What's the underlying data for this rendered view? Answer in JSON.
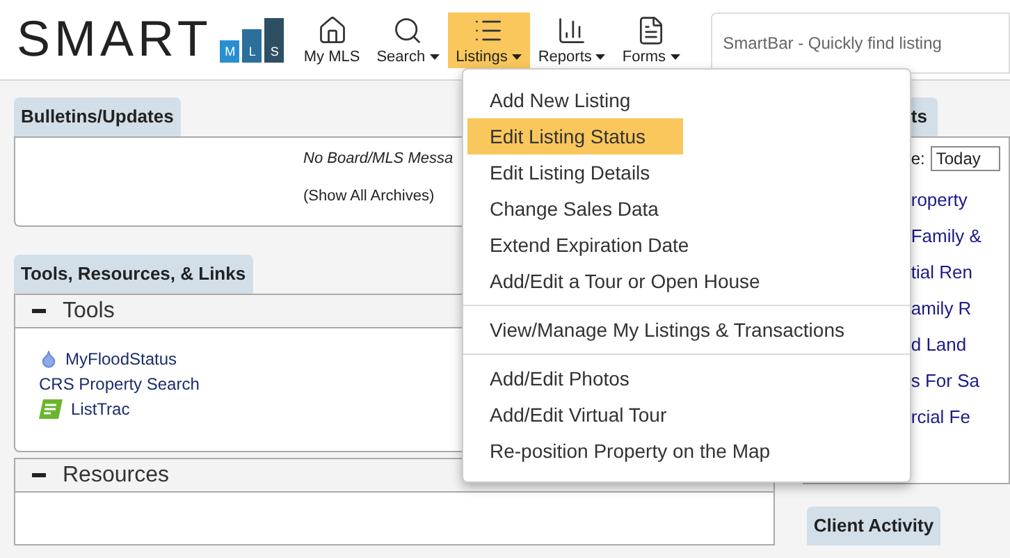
{
  "logo": {
    "text": "SMART",
    "badges": [
      "M",
      "L",
      "S"
    ]
  },
  "nav": [
    {
      "label": "My MLS",
      "kind": "home",
      "caret": false,
      "selected": false
    },
    {
      "label": "Search",
      "kind": "search",
      "caret": true,
      "selected": false
    },
    {
      "label": "Listings",
      "kind": "list",
      "caret": true,
      "selected": true
    },
    {
      "label": "Reports",
      "kind": "chart",
      "caret": true,
      "selected": false
    },
    {
      "label": "Forms",
      "kind": "form",
      "caret": true,
      "selected": false
    }
  ],
  "smartbar": {
    "placeholder": "SmartBar - Quickly find listing"
  },
  "bulletins": {
    "title": "Bulletins/Updates",
    "message": "No Board/MLS Messa",
    "link": "(Show All Archives)"
  },
  "tools_section": {
    "title": "Tools, Resources, & Links",
    "groups": [
      {
        "title": "Tools",
        "expanded": true,
        "items": [
          {
            "label": "MyFloodStatus",
            "kind": "drop"
          },
          {
            "label": "CRS Property Search",
            "kind": "plain"
          },
          {
            "label": "ListTrac",
            "kind": "listtrac"
          }
        ]
      },
      {
        "title": "Resources",
        "expanded": true
      }
    ]
  },
  "right_panel": {
    "title": "ts",
    "filter_label": "e:",
    "filter_value": "Today",
    "links": [
      "roperty",
      "Family &",
      "tial Ren",
      "amily R",
      "d Land",
      "s For Sa",
      "rcial Fe"
    ]
  },
  "client_activity": {
    "title": "Client Activity"
  },
  "listings_menu": {
    "groups": [
      [
        {
          "label": "Add New Listing",
          "selected": false
        },
        {
          "label": "Edit Listing Status",
          "selected": true
        },
        {
          "label": "Edit Listing Details",
          "selected": false
        },
        {
          "label": "Change Sales Data",
          "selected": false
        },
        {
          "label": "Extend Expiration Date",
          "selected": false
        },
        {
          "label": "Add/Edit a Tour or Open House",
          "selected": false
        }
      ],
      [
        {
          "label": "View/Manage My Listings & Transactions",
          "selected": false
        }
      ],
      [
        {
          "label": "Add/Edit Photos",
          "selected": false
        },
        {
          "label": "Add/Edit Virtual Tour",
          "selected": false
        },
        {
          "label": "Re-position Property on the Map",
          "selected": false
        }
      ]
    ]
  }
}
